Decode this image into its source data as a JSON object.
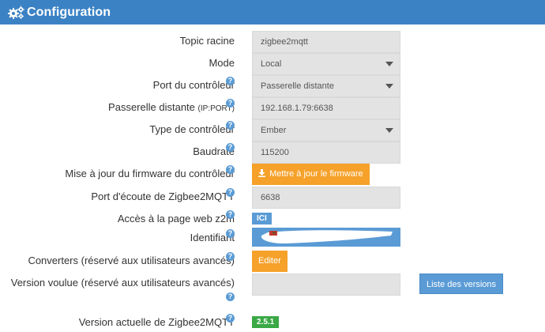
{
  "header": {
    "title": "Configuration",
    "icon": "cogs-icon"
  },
  "fields": {
    "topic_racine": {
      "label": "Topic racine",
      "value": "zigbee2mqtt"
    },
    "mode": {
      "label": "Mode",
      "value": "Local"
    },
    "port_controleur": {
      "label": "Port du contrôleur",
      "value": "Passerelle distante"
    },
    "passerelle_distante": {
      "label": "Passerelle distante",
      "label_suffix": "(IP:PORT)",
      "value": "192.168.1.79:6638"
    },
    "type_controleur": {
      "label": "Type de contrôleur",
      "value": "Ember"
    },
    "baudrate": {
      "label": "Baudrate",
      "value": "115200"
    },
    "firmware": {
      "label": "Mise à jour du firmware du contrôleur",
      "button": "Mettre à jour le firmware"
    },
    "port_ecoute": {
      "label": "Port d'écoute de Zigbee2MQTT",
      "value": "6638"
    },
    "acces_web": {
      "label": "Accès à la page web z2m",
      "button": "ICI"
    },
    "identifiant": {
      "label": "Identifiant"
    },
    "converters": {
      "label": "Converters (réservé aux utilisateurs avancés)",
      "button": "Editer"
    },
    "version_voulue": {
      "label": "Version voulue (réservé aux utilisateurs avancés)",
      "value": "",
      "button": "Liste des versions"
    },
    "version_actuelle": {
      "label": "Version actuelle de Zigbee2MQTT",
      "value": "2.5.1"
    }
  },
  "help_glyph": "?",
  "colors": {
    "header": "#3b82c4",
    "primary": "#5a9bd5",
    "warning": "#f5a12a",
    "success": "#3aa845"
  }
}
